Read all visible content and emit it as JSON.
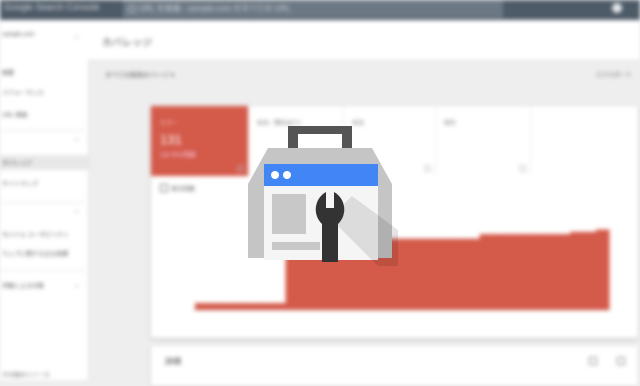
{
  "app": {
    "title": "Google Search Console",
    "search_placeholder": "URL を検査 - sample.com のすべての URL",
    "settings_icon": "settings-icon",
    "search_icon": "search-icon"
  },
  "sidebar": {
    "property": "sample.com",
    "items": [
      {
        "label": "概要"
      },
      {
        "label": "パフォーマンス"
      },
      {
        "label": "URL 検査"
      },
      {
        "label": "カバレッジ"
      },
      {
        "label": "サイトマップ"
      },
      {
        "label": "モバイル ユーザビリティ"
      },
      {
        "label": "ウェブに関する主な指標"
      },
      {
        "label": "手動による対策"
      },
      {
        "label": "その他のリソース"
      }
    ]
  },
  "page": {
    "title": "カバレッジ",
    "filter_label": "すべての既知のページ",
    "export_label": "エクスポート"
  },
  "metrics": [
    {
      "label": "エラー",
      "value": "131",
      "sub": "130 件の問題"
    },
    {
      "label": "有効（警告あり）",
      "value": "",
      "sub": ""
    },
    {
      "label": "有効",
      "value": "",
      "sub": ""
    },
    {
      "label": "除外",
      "value": "",
      "sub": ""
    }
  ],
  "chart_legend": "表示回数",
  "chart_data": {
    "type": "area",
    "title": "",
    "xlabel": "",
    "ylabel": "",
    "series": [
      {
        "values": [
          3,
          3,
          3,
          3,
          3,
          3,
          3,
          31,
          31,
          31,
          31,
          31,
          31,
          31,
          31,
          31,
          31,
          31,
          31,
          31,
          31,
          31,
          33,
          33,
          33,
          33,
          33,
          33,
          33,
          34,
          34,
          35
        ]
      }
    ],
    "ylim": [
      0,
      40
    ],
    "grid": false,
    "color": "#d45a4a"
  },
  "details": {
    "title": "詳細"
  },
  "logo": {
    "icon": "search-console-logo",
    "colors": {
      "box": "#c5c5c5",
      "header": "#4285f4",
      "wrench": "#333333",
      "handle": "#555555"
    }
  }
}
